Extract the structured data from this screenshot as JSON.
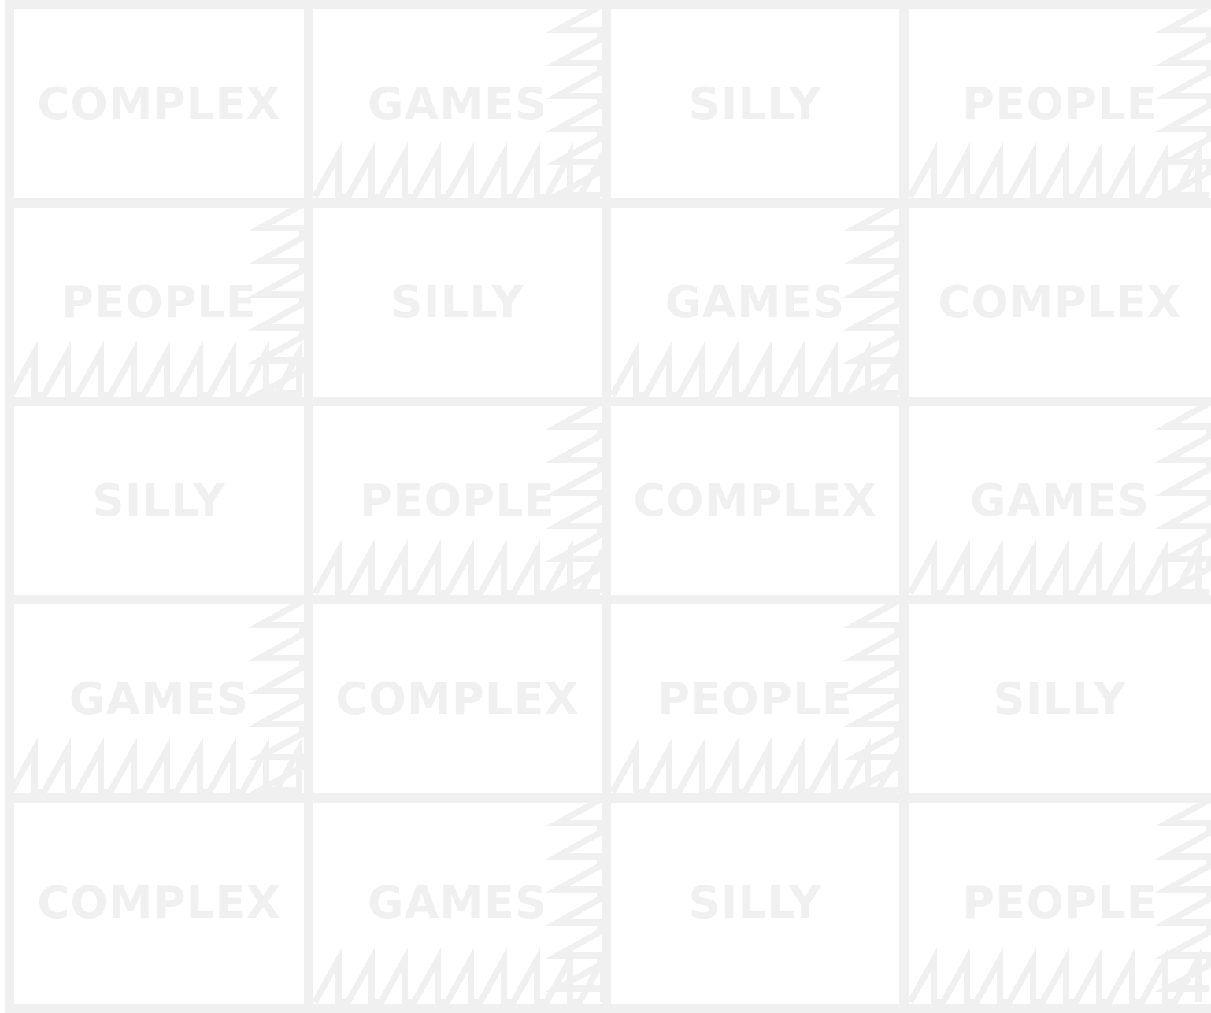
{
  "colors": {
    "background": "#ffffff",
    "line": "#f0f0f0",
    "text": "#f0f0f0"
  },
  "pattern": {
    "rows": [
      [
        "COMPLEX",
        "GAMES",
        "SILLY",
        "PEOPLE"
      ],
      [
        "PEOPLE",
        "SILLY",
        "GAMES",
        "COMPLEX"
      ],
      [
        "SILLY",
        "PEOPLE",
        "COMPLEX",
        "GAMES"
      ],
      [
        "GAMES",
        "COMPLEX",
        "PEOPLE",
        "SILLY"
      ],
      [
        "COMPLEX",
        "GAMES",
        "SILLY",
        "PEOPLE"
      ]
    ]
  }
}
